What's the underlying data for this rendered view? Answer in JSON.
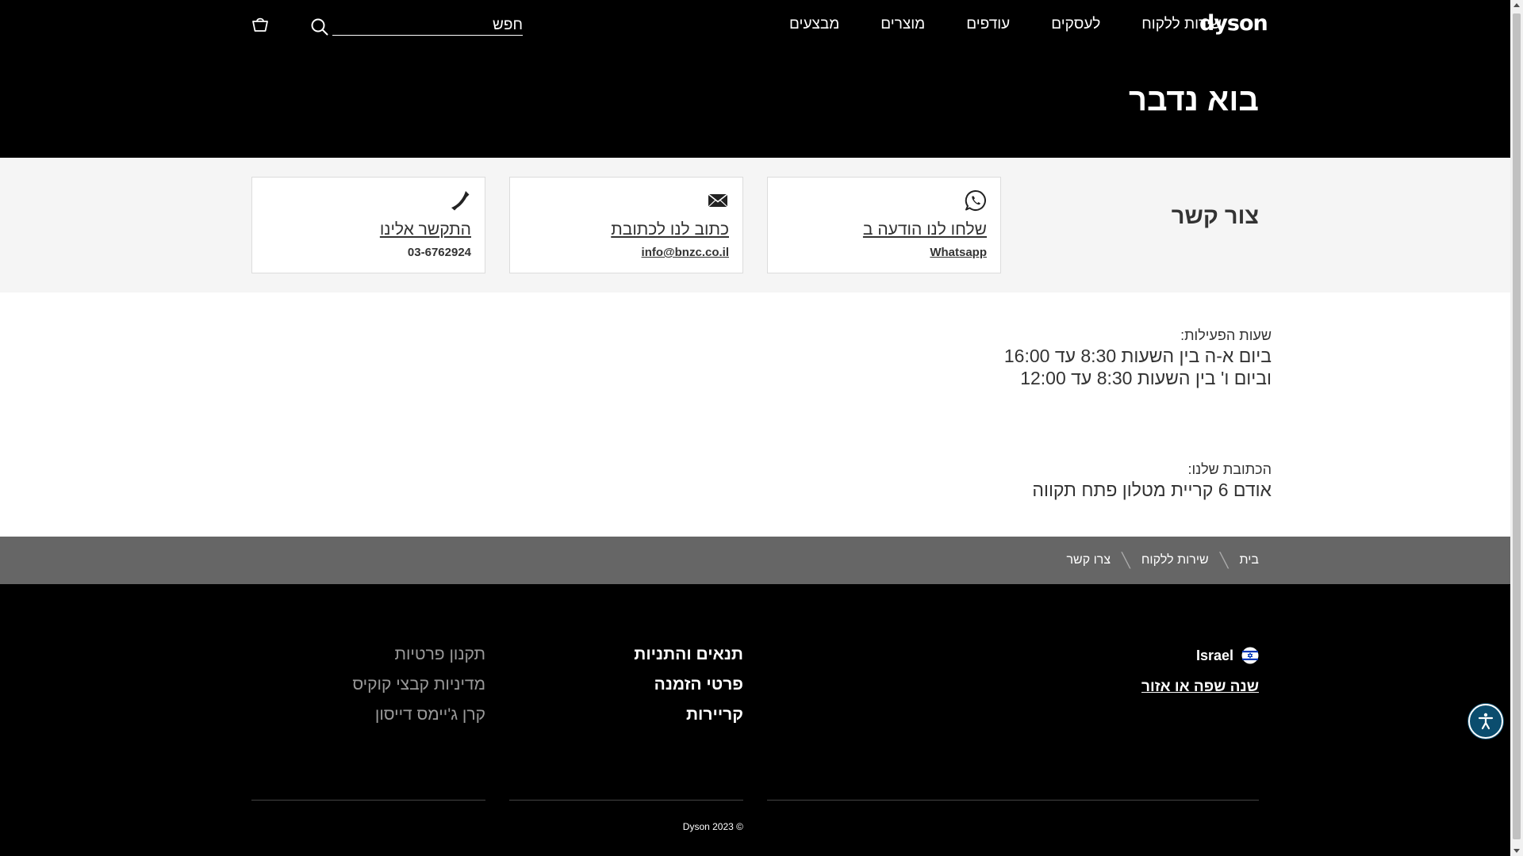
{
  "header": {
    "logo": "dyson",
    "nav": [
      "מבצעים",
      "מוצרים",
      "עודפים",
      "לעסקים",
      "שירות ללקוח"
    ],
    "search_placeholder": "חפש",
    "page_title": "בוא נדבר"
  },
  "contact": {
    "heading": "צור קשר",
    "whatsapp": {
      "link": "שלחו לנו הודעה ב",
      "detail": "Whatsapp"
    },
    "email": {
      "link": "כתוב לנו לכתובת",
      "detail": "info@bnzc.co.il"
    },
    "phone": {
      "link": "התקשר אלינו",
      "detail": "03-6762924"
    }
  },
  "hours": {
    "label": "שעות הפעילות:",
    "lines": [
      "ביום א-ה בין השעות 8:30 עד 16:00",
      "וביום ו' בין השעות 8:30 עד 12:00"
    ]
  },
  "address": {
    "label": "הכתובת שלנו:",
    "line": "אודם 6 קריית מטלון פתח תקווה"
  },
  "breadcrumb": [
    "בית",
    "שירות ללקוח",
    "צרו קשר"
  ],
  "footer": {
    "country": "Israel",
    "change_region": "שנה שפה או אזור",
    "primary_links": [
      "תנאים והתניות",
      "פרטי הזמנה",
      "קריירות"
    ],
    "secondary_links": [
      "תקנון פרטיות",
      "מדיניות קבצי קוקיס",
      "קרן ג'יימס דייסון"
    ],
    "copyright": "Dyson 2023 ©"
  },
  "colors": {
    "header_bg": "#000000",
    "contact_band_bg": "#f5f5f5",
    "breadcrumb_bg": "#666666",
    "footer_bg": "#000000",
    "accessibility_button": "#0b4d6e"
  },
  "icons": [
    "search-icon",
    "basket-icon",
    "whatsapp-icon",
    "envelope-icon",
    "phone-icon",
    "israel-flag-icon",
    "accessibility-icon"
  ]
}
